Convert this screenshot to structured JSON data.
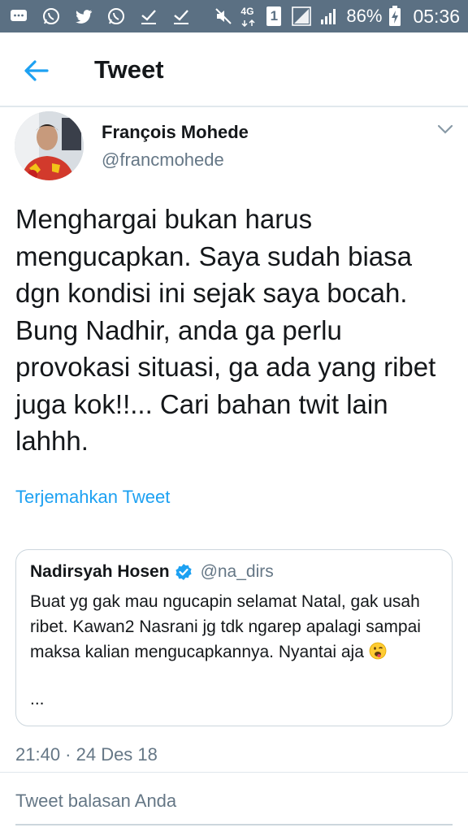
{
  "status_bar": {
    "left_icons": [
      "chat-bubble-icon",
      "whatsapp-icon",
      "twitter-icon",
      "whatsapp-icon",
      "download-done-icon",
      "download-done-icon"
    ],
    "network": "4G",
    "sim": "1",
    "battery": "86%",
    "time": "05:36"
  },
  "header": {
    "title": "Tweet"
  },
  "tweet": {
    "author_name": "François Mohede",
    "author_handle": "@francmohede",
    "text": "Menghargai bukan harus mengucapkan. Saya sudah biasa dgn kondisi ini sejak saya bocah. Bung Nadhir, anda ga perlu provokasi situasi, ga ada yang ribet juga kok!!... Cari bahan twit lain lahhh.",
    "translate_label": "Terjemahkan Tweet",
    "timestamp": "21:40 · 24 Des 18"
  },
  "quoted_tweet": {
    "author_name": "Nadirsyah Hosen",
    "author_handle": "@na_dirs",
    "text": "Buat yg gak mau ngucapin selamat Natal, gak usah ribet. Kawan2 Nasrani jg tdk ngarep apalagi sampai maksa kalian mengucapkannya. Nyantai aja",
    "ellipsis": "..."
  },
  "reply": {
    "placeholder": "Tweet balasan Anda"
  },
  "colors": {
    "status_bar": "#5b7083",
    "accent": "#1da1f2",
    "secondary_text": "#657786",
    "border": "#ccd6dd"
  }
}
